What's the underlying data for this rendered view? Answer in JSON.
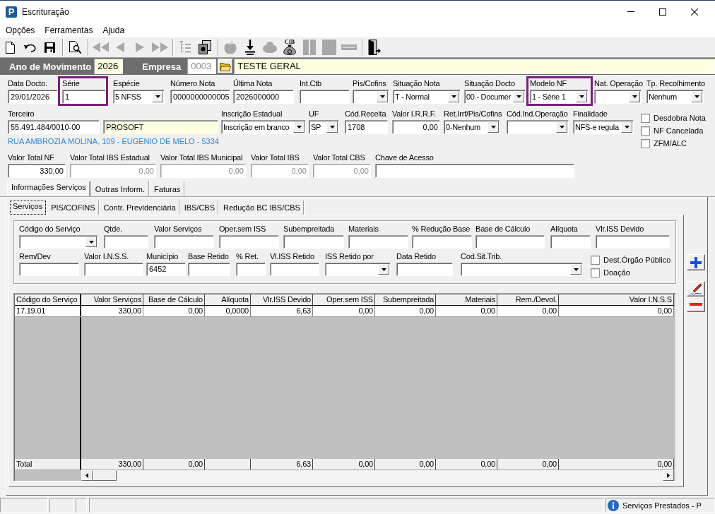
{
  "window": {
    "icon_text": "P",
    "title": "Escrituração"
  },
  "menu": [
    {
      "label": "Opções"
    },
    {
      "label": "Ferramentas"
    },
    {
      "label": "Ajuda"
    }
  ],
  "toolbar": [
    [
      {
        "disabled": false
      },
      {
        "disabled": false
      },
      {
        "disabled": false
      }
    ],
    [
      {
        "disabled": false
      }
    ],
    [
      {
        "disabled": true
      },
      {
        "disabled": true
      },
      {
        "disabled": true
      },
      {
        "disabled": true
      }
    ],
    [
      {
        "disabled": true
      },
      {
        "disabled": false
      }
    ],
    [
      {
        "disabled": true
      },
      {
        "disabled": false
      },
      {
        "disabled": true
      },
      {
        "disabled": false,
        "label": "CIB"
      },
      {
        "disabled": true
      },
      {
        "disabled": true
      },
      {
        "disabled": true
      }
    ],
    [
      {
        "disabled": false
      }
    ]
  ],
  "header": {
    "year_label": "Ano de Movimento",
    "year": "2026",
    "company_label": "Empresa",
    "company_code": {
      "value": "0003",
      "disabled": true
    },
    "company_name": "TESTE GERAL"
  },
  "document": {
    "main_fields": [
      {
        "label": "Data Docto.",
        "kind": "text",
        "value": "29/01/2026",
        "disabled": false,
        "highlighted": false
      },
      {
        "label": "Série",
        "kind": "text",
        "value": "1",
        "disabled": false,
        "highlighted": true
      },
      {
        "label": "Espécie",
        "kind": "combo",
        "value": "5 NFSS",
        "disabled": false,
        "highlighted": false
      },
      {
        "label": "Número Nota",
        "kind": "text",
        "value": "0000000000005",
        "disabled": false,
        "highlighted": false
      },
      {
        "label": "Última Nota",
        "kind": "text",
        "value": "2026000000",
        "disabled": false,
        "highlighted": false
      },
      {
        "label": "Int.Ctb",
        "kind": "text",
        "disabled": false,
        "highlighted": false
      },
      {
        "label": "Pis/Cofins",
        "kind": "combo",
        "disabled": false,
        "highlighted": false
      },
      {
        "label": "Situação Nota",
        "kind": "combo",
        "value": "T - Normal",
        "disabled": false,
        "highlighted": false
      },
      {
        "label": "Situação Docto",
        "kind": "combo",
        "value": "00 - Documer",
        "disabled": false,
        "highlighted": false
      },
      {
        "label": "Modelo NF",
        "kind": "combo",
        "value": "1 - Série 1",
        "disabled": false,
        "highlighted": true
      },
      {
        "label": "Nat. Operação",
        "kind": "combo",
        "disabled": false,
        "highlighted": false
      },
      {
        "label": "Tp. Recolhimento",
        "kind": "combo",
        "value": "Nenhum",
        "disabled": false,
        "highlighted": false
      }
    ],
    "party_fields": [
      {
        "label": "Terceiro",
        "kind": "text",
        "value": "55.491.484/0010-00",
        "disabled": false
      },
      {
        "kind": "lookup",
        "value": "PROSOFT",
        "disabled": false
      },
      {
        "label": "Inscrição Estadual",
        "kind": "combo",
        "value": "Inscrição em branco",
        "disabled": false
      },
      {
        "label": "UF",
        "kind": "combo",
        "value": "SP",
        "disabled": false
      },
      {
        "label": "Cód.Receita",
        "kind": "text",
        "value": "1708",
        "disabled": false
      },
      {
        "label": "Valor I.R.R.F.",
        "kind": "number",
        "value": "0,00",
        "disabled": false
      },
      {
        "label": "Ret.Irrf/Pis/Cofins",
        "kind": "combo",
        "value": "0-Nenhum",
        "disabled": false
      },
      {
        "label": "Cód.Ind.Operação",
        "kind": "combo",
        "disabled": false
      },
      {
        "label": "Finalidade",
        "kind": "combo",
        "value": "NFS-e regula",
        "disabled": false
      }
    ],
    "address": "RUA AMBROZIA MOLINA, 109 - EUGENIO DE MELO - 5334",
    "flags": [
      {
        "label": "Desdobra Nota",
        "checked": false
      },
      {
        "label": "NF Cancelada",
        "checked": false
      },
      {
        "label": "ZFM/ALC",
        "checked": false
      }
    ],
    "total_fields": [
      {
        "label": "Valor Total NF",
        "kind": "number",
        "value": "330,00",
        "disabled": false
      },
      {
        "label": "Valor Total IBS Estadual",
        "kind": "number",
        "value": "0,00",
        "disabled": true
      },
      {
        "label": "Valor Total IBS Municipal",
        "kind": "number",
        "value": "0,00",
        "disabled": true
      },
      {
        "label": "Valor Total IBS",
        "kind": "number",
        "value": "0,00",
        "disabled": true
      },
      {
        "label": "Valor Total CBS",
        "kind": "number",
        "value": "0,00",
        "disabled": true
      },
      {
        "label": "Chave de Acesso",
        "kind": "text",
        "disabled": false
      }
    ]
  },
  "tabs": [
    {
      "label": "Informações Serviços",
      "selected": true
    },
    {
      "label": "Outras Inform.",
      "selected": false
    },
    {
      "label": "Faturas",
      "selected": false
    }
  ],
  "subtabs": [
    {
      "label": "Serviços",
      "selected": true
    },
    {
      "label": "PIS/COFINS",
      "selected": false
    },
    {
      "label": "Contr. Previdenciária",
      "selected": false
    },
    {
      "label": "IBS/CBS",
      "selected": false
    },
    {
      "label": "Redução BC IBS/CBS",
      "selected": false
    }
  ],
  "service": {
    "fields_1": [
      {
        "label": "Código do Serviço",
        "kind": "combo"
      },
      {
        "label": "Qtde.",
        "kind": "text"
      },
      {
        "label": "Valor Serviços",
        "kind": "text"
      },
      {
        "label": "Oper.sem ISS",
        "kind": "text"
      },
      {
        "label": "Subempreitada",
        "kind": "text"
      },
      {
        "label": "Materiais",
        "kind": "text"
      },
      {
        "label": "% Redução Base",
        "kind": "text"
      },
      {
        "label": "Base de Cálculo",
        "kind": "text"
      },
      {
        "label": "Alíquota",
        "kind": "text"
      },
      {
        "label": "Vlr.ISS Devido",
        "kind": "text"
      }
    ],
    "fields_2": [
      {
        "label": "Rem/Dev",
        "kind": "text"
      },
      {
        "label": "Valor I.N.S.S.",
        "kind": "text"
      },
      {
        "label": "Município",
        "kind": "text",
        "value": "6452"
      },
      {
        "label": "Base Retido",
        "kind": "text"
      },
      {
        "label": "% Ret.",
        "kind": "text"
      },
      {
        "label": "Vl.ISS Retido",
        "kind": "text"
      },
      {
        "label": "ISS Retido por",
        "kind": "combo"
      },
      {
        "label": "Data Retido",
        "kind": "text"
      },
      {
        "label": "Cod.Sit.Trib.",
        "kind": "combo"
      }
    ],
    "flags": [
      {
        "label": "Dest.Órgão Público",
        "checked": false
      },
      {
        "label": "Doação",
        "checked": false
      }
    ]
  },
  "table": {
    "columns": [
      "Código do Serviço",
      "Valor Serviços",
      "Base de Cálculo",
      "Alíquota",
      "Vlr.ISS Devido",
      "Oper.sem ISS",
      "Subempreitada",
      "Materiais",
      "Rem./Devol.",
      "Valor I.N.S.S"
    ],
    "rows": [
      [
        "17.19.01",
        "330,00",
        "0,00",
        "0,0000",
        "6,63",
        "0,00",
        "0,00",
        "0,00",
        "0,00",
        "0,00"
      ]
    ],
    "total": {
      "label": "Total",
      "valor_servicos": "330,00",
      "base_de_calculo": "0,00",
      "vlr_iss_devido": "6,63",
      "oper_sem_iss": "0,00",
      "subempreitada": "0,00",
      "materiais": "0,00",
      "rem_devol": "0,00",
      "valor_inss": "0,00"
    }
  },
  "status_bar": {
    "message": "Serviços Prestados - P"
  }
}
